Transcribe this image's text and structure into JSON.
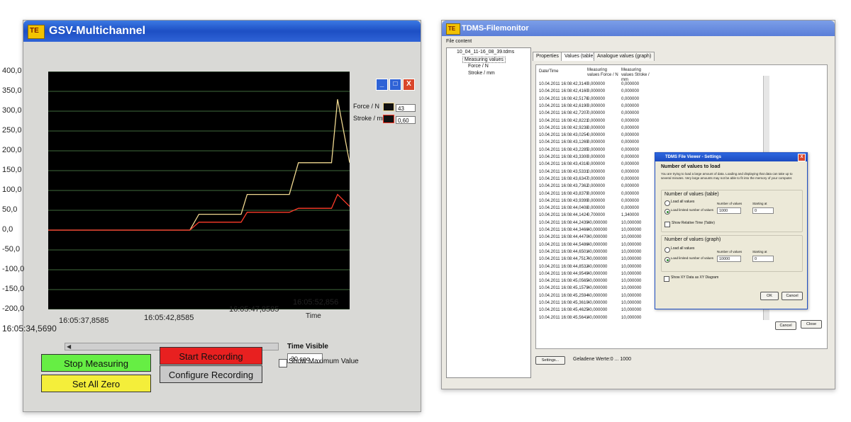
{
  "left_window": {
    "title": "GSV-Multichannel",
    "y_ticks": [
      "400,0",
      "350,0",
      "300,0",
      "250,0",
      "200,0",
      "150,0",
      "100,0",
      "50,0",
      "0,0",
      "-50,0",
      "-100,0",
      "-150,0",
      "-200,0"
    ],
    "x_ticks": [
      "16:05:34,5690",
      "16:05:37,8585",
      "16:05:42,8585",
      "16:05:47,8585",
      "16:05:52,856"
    ],
    "x_axis_label": "Time",
    "legend": [
      {
        "label": "Force / N",
        "value": "43",
        "color": "#f0d890"
      },
      {
        "label": "Stroke / mm",
        "value": "0,60",
        "color": "#ff3b2a"
      }
    ],
    "buttons": {
      "stop_measuring": "Stop Measuring",
      "start_recording": "Start Recording",
      "set_all_zero": "Set All Zero",
      "configure_recording": "Configure Recording"
    },
    "time_visible_label": "Time Visible",
    "time_visible_value": "20 sec",
    "show_max_label": "Show Maximum Value",
    "colors": {
      "stop": "#66ee44",
      "start": "#e82020",
      "zero": "#f4ee3a",
      "configure": "#c8c8c8",
      "grid": "#7fd37a"
    }
  },
  "chart_data": {
    "type": "line",
    "xlabel": "Time",
    "ylim": [
      -200,
      400
    ],
    "x_ticks": [
      "16:05:34,5690",
      "16:05:37,8585",
      "16:05:42,8585",
      "16:05:47,8585",
      "16:05:52,856"
    ],
    "series": [
      {
        "name": "Force / N",
        "color": "#f0d890",
        "x": [
          0,
          0.47,
          0.5,
          0.64,
          0.66,
          0.8,
          0.83,
          0.94,
          0.96,
          1.0
        ],
        "values": [
          0,
          0,
          40,
          40,
          90,
          90,
          170,
          170,
          330,
          170
        ]
      },
      {
        "name": "Stroke / mm",
        "color": "#ff3b2a",
        "x": [
          0,
          0.47,
          0.5,
          0.64,
          0.66,
          0.8,
          0.83,
          0.94,
          0.96,
          1.0
        ],
        "values": [
          0,
          0,
          20,
          20,
          45,
          45,
          55,
          55,
          90,
          60
        ]
      }
    ],
    "grid": true
  },
  "right_window": {
    "title": "TDMS-Filemonitor",
    "menu": "File content",
    "tree": [
      "10_04_11-16_08_39.tdms",
      "Measuring values",
      "Force / N",
      "Stroke / mm"
    ],
    "tabs": [
      "Properties",
      "Values (table)",
      "Analogue values (graph)"
    ],
    "columns": [
      "Date/Time",
      "Measuring values Force / N",
      "Measuring values Stroke / mm"
    ],
    "rows": [
      [
        "10.04.2011 16:08:42,3140",
        "0,000000",
        "0,000000"
      ],
      [
        "10.04.2011 16:08:42,4160",
        "0,000000",
        "0,000000"
      ],
      [
        "10.04.2011 16:08:42,5176",
        "0,000000",
        "0,000000"
      ],
      [
        "10.04.2011 16:08:42,6190",
        "0,000000",
        "0,000000"
      ],
      [
        "10.04.2011 16:08:42,7207",
        "0,000000",
        "0,000000"
      ],
      [
        "10.04.2011 16:08:42,8221",
        "0,000000",
        "0,000000"
      ],
      [
        "10.04.2011 16:08:42,9238",
        "0,000000",
        "0,000000"
      ],
      [
        "10.04.2011 16:08:43,0254",
        "0,000000",
        "0,000000"
      ],
      [
        "10.04.2011 16:08:43,1269",
        "0,000000",
        "0,000000"
      ],
      [
        "10.04.2011 16:08:43,2285",
        "0,000000",
        "0,000000"
      ],
      [
        "10.04.2011 16:08:43,3300",
        "0,000000",
        "0,000000"
      ],
      [
        "10.04.2011 16:08:43,4316",
        "0,000000",
        "0,000000"
      ],
      [
        "10.04.2011 16:08:43,5331",
        "0,000000",
        "0,000000"
      ],
      [
        "10.04.2011 16:08:43,6347",
        "0,000000",
        "0,000000"
      ],
      [
        "10.04.2011 16:08:43,7362",
        "0,000000",
        "0,000000"
      ],
      [
        "10.04.2011 16:08:43,8379",
        "0,000000",
        "0,000000"
      ],
      [
        "10.04.2011 16:08:43,9399",
        "0,000000",
        "0,000000"
      ],
      [
        "10.04.2011 16:08:44,0408",
        "0,000000",
        "0,000000"
      ],
      [
        "10.04.2011 16:08:44,1424",
        "0,700000",
        "1,340000"
      ],
      [
        "10.04.2011 16:08:44,2439",
        "40,000000",
        "10,000000"
      ],
      [
        "10.04.2011 16:08:44,3466",
        "40,000000",
        "10,000000"
      ],
      [
        "10.04.2011 16:08:44,4470",
        "40,000000",
        "10,000000"
      ],
      [
        "10.04.2011 16:08:44,5486",
        "40,000000",
        "10,000000"
      ],
      [
        "10.04.2011 16:08:44,6501",
        "40,000000",
        "10,000000"
      ],
      [
        "10.04.2011 16:08:44,7517",
        "40,000000",
        "10,000000"
      ],
      [
        "10.04.2011 16:08:44,8532",
        "40,000000",
        "10,000000"
      ],
      [
        "10.04.2011 16:08:44,9549",
        "40,000000",
        "10,000000"
      ],
      [
        "10.04.2011 16:08:45,0565",
        "40,000000",
        "10,000000"
      ],
      [
        "10.04.2011 16:08:45,1579",
        "40,000000",
        "10,000000"
      ],
      [
        "10.04.2011 16:08:45,2594",
        "40,000000",
        "10,000000"
      ],
      [
        "10.04.2011 16:08:45,3610",
        "40,000000",
        "10,000000"
      ],
      [
        "10.04.2011 16:08:45,4625",
        "40,000000",
        "10,000000"
      ],
      [
        "10.04.2011 16:08:45,5641",
        "40,000000",
        "10,000000"
      ]
    ],
    "settings_button": "Settings...",
    "status": "Geladene Werte:0 ... 1000",
    "cancel_button": "Cancel",
    "close_button": "Close",
    "dialog": {
      "title": "TDMS File Viewer - Settings",
      "heading": "Number of values to load",
      "info": "You are trying to load a large amount of data. Loading and displaying that data can take up to several minutes. Very large amounts may not be able to fit into the memory of your computer.",
      "table_group": "Number of values (table)",
      "load_all": "Load all values",
      "load_limited": "Load limited number of values",
      "number_label": "Number of values",
      "starting_label": "Starting at",
      "table_number": "1000",
      "table_start": "0",
      "show_relative": "Show Relative Time (Table)",
      "graph_group": "Number of values (graph)",
      "graph_number": "10000",
      "graph_start": "0",
      "show_xy": "Show XY Data as XY Diagram",
      "ok": "OK",
      "cancel": "Cancel"
    }
  }
}
